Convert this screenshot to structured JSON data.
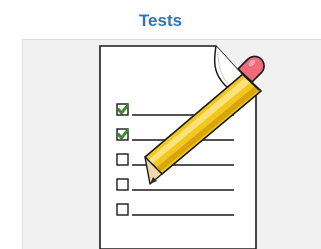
{
  "tile": {
    "title": "Tests",
    "icon": "checklist-with-pencil-icon",
    "checklist": {
      "items": [
        {
          "checked": true
        },
        {
          "checked": true
        },
        {
          "checked": false
        },
        {
          "checked": false
        },
        {
          "checked": false
        }
      ]
    }
  },
  "colors": {
    "title": "#2f74b5",
    "panel": "#f1f1f1",
    "check": "#3b8a2c",
    "pencil_body": "#f2c81e",
    "eraser": "#f06a7a"
  }
}
